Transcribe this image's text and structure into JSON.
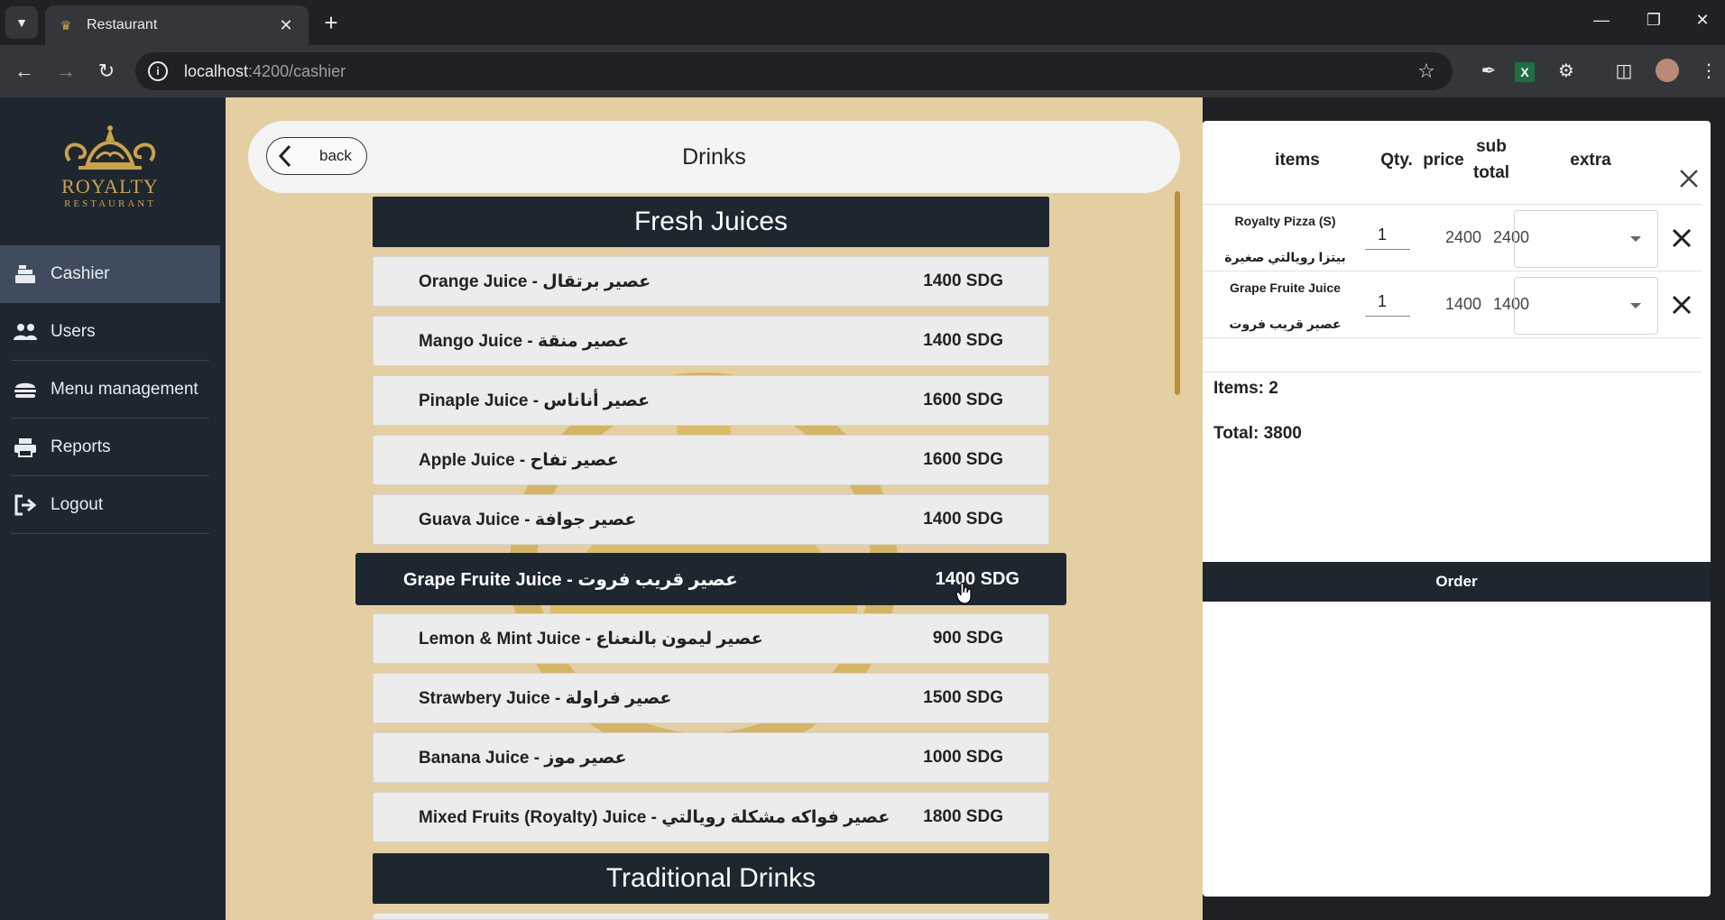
{
  "browser": {
    "tab_title": "Restaurant",
    "url_host": "localhost",
    "url_rest": ":4200/cashier"
  },
  "sidebar": {
    "logo_name": "ROYALTY",
    "logo_sub": "RESTAURANT",
    "items": [
      {
        "label": "Cashier",
        "icon": "cash-register-icon",
        "active": true
      },
      {
        "label": "Users",
        "icon": "users-icon",
        "active": false
      },
      {
        "label": "Menu management",
        "icon": "burger-icon",
        "active": false
      },
      {
        "label": "Reports",
        "icon": "printer-icon",
        "active": false
      },
      {
        "label": "Logout",
        "icon": "logout-icon",
        "active": false
      }
    ]
  },
  "header": {
    "back_label": "back",
    "title": "Drinks"
  },
  "menu": {
    "sections": [
      {
        "title": "Fresh Juices"
      },
      {
        "title": "Traditional Drinks"
      }
    ],
    "items": [
      {
        "name": "Orange Juice - عصير برتقال",
        "price": "1400 SDG"
      },
      {
        "name": "Mango Juice - عصير منقة",
        "price": "1400 SDG"
      },
      {
        "name": "Pinaple Juice - عصير أناناس",
        "price": "1600 SDG"
      },
      {
        "name": "Apple Juice - عصير تفاح",
        "price": "1600 SDG"
      },
      {
        "name": "Guava Juice - عصير جوافة",
        "price": "1400 SDG"
      },
      {
        "name": "Grape Fruite Juice - عصير قريب فروت",
        "price": "1400 SDG"
      },
      {
        "name": "Lemon & Mint Juice - عصير ليمون بالنعناع",
        "price": "900 SDG"
      },
      {
        "name": "Strawbery Juice - عصير فراولة",
        "price": "1500 SDG"
      },
      {
        "name": "Banana Juice - عصير موز",
        "price": "1000 SDG"
      },
      {
        "name": "Mixed Fruits (Royalty) Juice - عصير فواكه مشكلة رويالتي",
        "price": "1800 SDG"
      }
    ]
  },
  "order": {
    "headers": {
      "items": "items",
      "qty": "Qty.",
      "price": "price",
      "sub_total_1": "sub",
      "sub_total_2": "total",
      "extra": "extra"
    },
    "rows": [
      {
        "name_en": "Royalty Pizza (S)",
        "name_ar": "بيتزا رويالتي صغيرة",
        "qty": "1",
        "price": "2400",
        "sub_total": "2400",
        "extra": ""
      },
      {
        "name_en": "Grape Fruite Juice",
        "name_ar": "عصير قريب فروت",
        "qty": "1",
        "price": "1400",
        "sub_total": "1400",
        "extra": ""
      }
    ],
    "items_count": "Items: 2",
    "total": "Total: 3800",
    "order_label": "Order"
  },
  "colors": {
    "sidebar_bg": "#1e2630",
    "main_bg": "#e4cfa2",
    "accent_gold": "#c9a24a"
  }
}
